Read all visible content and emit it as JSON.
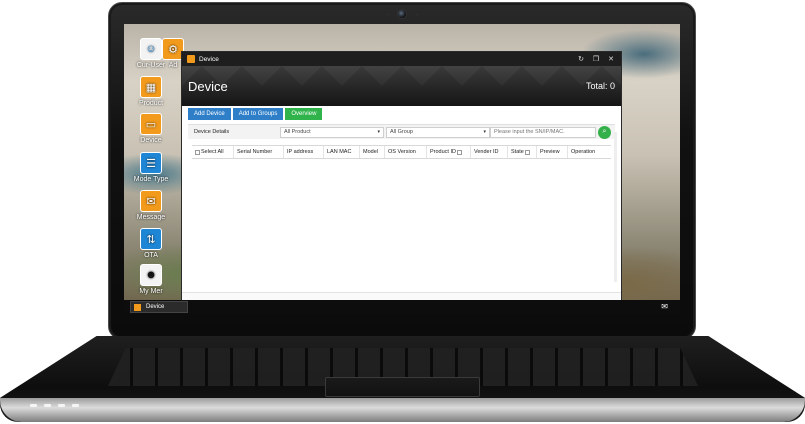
{
  "desktop": {
    "icons": [
      {
        "label": "Cur-User",
        "glyph": "☺",
        "color": "white",
        "icon": "user-icon"
      },
      {
        "label": "Ad",
        "glyph": "⚙",
        "color": "orange",
        "icon": "admin-icon"
      },
      {
        "label": "Product",
        "glyph": "▦",
        "color": "orange",
        "icon": "product-icon"
      },
      {
        "label": "Device",
        "glyph": "▭",
        "color": "orange",
        "icon": "device-icon"
      },
      {
        "label": "Mode Type",
        "glyph": "☰",
        "color": "blue",
        "icon": "mode-type-icon"
      },
      {
        "label": "Message",
        "glyph": "✉",
        "color": "orange",
        "icon": "message-icon"
      },
      {
        "label": "OTA",
        "glyph": "⇅",
        "color": "blue",
        "icon": "ota-icon"
      },
      {
        "label": "My Mer",
        "glyph": "☻",
        "color": "white",
        "icon": "users-icon"
      }
    ]
  },
  "window": {
    "title": "Device",
    "controls": {
      "refresh": "↻",
      "restore": "❐",
      "close": "✕"
    },
    "header": {
      "title": "Device",
      "total": "Total: 0"
    },
    "toolbar": {
      "add_device": "Add Device",
      "add_to_groups": "Add to Groups",
      "overview": "Overview"
    },
    "filters": {
      "label": "Device Details",
      "product_select": "All Product",
      "group_select": "All Group",
      "search_placeholder": "Please input the SN/IP/MAC.",
      "caret": "▾",
      "search_glyph": "⌕"
    },
    "table": {
      "columns": [
        "Select All",
        "Serial Number",
        "IP address",
        "LAN MAC",
        "Model",
        "OS Version",
        "Product ID",
        "Vender ID",
        "State",
        "Preview",
        "Operation"
      ],
      "rows": []
    }
  },
  "taskbar": {
    "items": [
      {
        "label": "Device"
      }
    ],
    "chat_glyph": "✉"
  },
  "colors": {
    "primary_blue": "#2f7fc8",
    "overview_green": "#2fb34a",
    "search_green": "#33b04a",
    "titlebar": "#1e1e1e",
    "app_orange": "#f29a1c"
  }
}
